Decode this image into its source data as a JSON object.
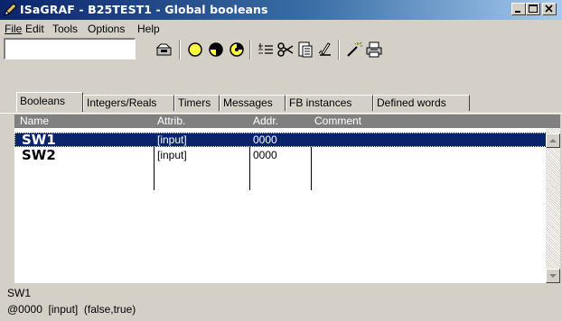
{
  "window": {
    "title": "ISaGRAF - B25TEST1 - Global booleans",
    "title_bar_colors": [
      "#0a246a",
      "#a6caf0"
    ]
  },
  "menu": {
    "items": [
      {
        "label": "File"
      },
      {
        "label": "Edit"
      },
      {
        "label": "Tools"
      },
      {
        "label": "Options"
      },
      {
        "label": "Help"
      }
    ]
  },
  "toolbar": {
    "field_value": "",
    "icons": [
      "open-folder-icon",
      "circle-empty-icon",
      "circle-half-icon",
      "circle-gear-icon",
      "list-insert-icon",
      "scissors-icon",
      "clipboard-icon",
      "edit-pen-icon",
      "magic-wand-icon",
      "printer-icon"
    ]
  },
  "tabs": [
    {
      "label": "Booleans",
      "active": true
    },
    {
      "label": "Integers/Reals"
    },
    {
      "label": "Timers"
    },
    {
      "label": "Messages"
    },
    {
      "label": "FB instances"
    },
    {
      "label": "Defined words"
    }
  ],
  "grid": {
    "columns": {
      "name": "Name",
      "attrib": "Attrib.",
      "addr": "Addr.",
      "comment": "Comment"
    },
    "rows": [
      {
        "name": "SW1",
        "attrib": "[input]",
        "addr": "0000",
        "comment": "",
        "selected": true
      },
      {
        "name": "SW2",
        "attrib": "[input]",
        "addr": "0000",
        "comment": ""
      }
    ],
    "selection_color": "#0a246a"
  },
  "status": {
    "line1": "SW1",
    "line2": "@0000  [input]  (false,true)"
  }
}
